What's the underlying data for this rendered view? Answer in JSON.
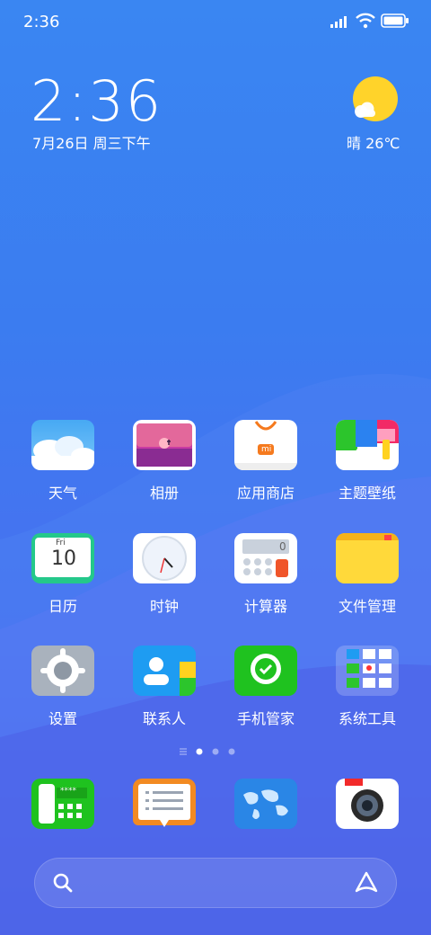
{
  "status_bar": {
    "time": "2:36"
  },
  "clock_widget": {
    "time": "2:36",
    "date": "7月26日 周三下午"
  },
  "weather_widget": {
    "text": "晴 26℃"
  },
  "apps_row1": [
    {
      "label": "天气",
      "icon": "weather-icon"
    },
    {
      "label": "相册",
      "icon": "gallery-icon"
    },
    {
      "label": "应用商店",
      "icon": "app-store-icon"
    },
    {
      "label": "主题壁纸",
      "icon": "themes-icon"
    }
  ],
  "apps_row2": [
    {
      "label": "日历",
      "icon": "calendar-icon",
      "day_name": "Fri",
      "day_number": "10"
    },
    {
      "label": "时钟",
      "icon": "clock-icon"
    },
    {
      "label": "计算器",
      "icon": "calculator-icon",
      "display_value": "0"
    },
    {
      "label": "文件管理",
      "icon": "file-manager-icon"
    }
  ],
  "apps_row3": [
    {
      "label": "设置",
      "icon": "settings-icon"
    },
    {
      "label": "联系人",
      "icon": "contacts-icon"
    },
    {
      "label": "手机管家",
      "icon": "security-icon"
    },
    {
      "label": "系统工具",
      "icon": "tools-folder-icon"
    }
  ],
  "dock": [
    {
      "icon": "phone-icon",
      "display": "****"
    },
    {
      "icon": "messages-icon"
    },
    {
      "icon": "browser-icon"
    },
    {
      "icon": "camera-icon"
    }
  ],
  "store_badge": "mi",
  "colors": {
    "accent_green": "#1fc21f",
    "folder_yellow": "#ffd93a",
    "search_red": "#e8332a"
  }
}
